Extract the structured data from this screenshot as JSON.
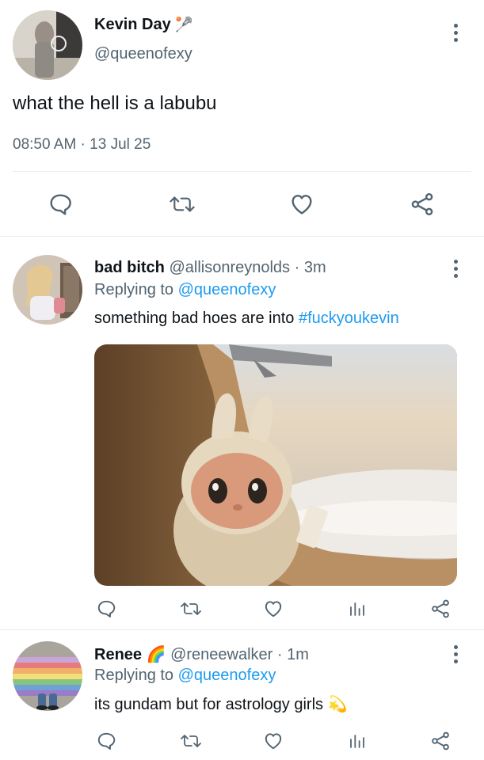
{
  "main_tweet": {
    "author_name": "Kevin Day",
    "author_emoji": "🥍",
    "author_handle": "@queenofexy",
    "text": "what the hell is a labubu",
    "timestamp": "08:50 AM · 13 Jul 25"
  },
  "replies": [
    {
      "author_name": "bad bitch",
      "author_handle": "@allisonreynolds",
      "time": "· 3m",
      "replying_label": "Replying to",
      "replying_handle": "@queenofexy",
      "text": "something bad hoes are into",
      "hashtag": "#fuckyoukevin"
    },
    {
      "author_name": "Renee",
      "author_emoji": "🌈",
      "author_handle": "@reneewalker",
      "time": "· 1m",
      "replying_label": "Replying to",
      "replying_handle": "@queenofexy",
      "text": "its gundam but for astrology girls",
      "text_emoji": "💫"
    }
  ],
  "icons": [
    "reply-icon",
    "retweet-icon",
    "like-icon",
    "analytics-icon",
    "share-icon",
    "more-icon"
  ],
  "colors": {
    "link": "#1d9bf0",
    "muted": "#536471",
    "text": "#0f1419",
    "divider": "#e6ecf0"
  }
}
